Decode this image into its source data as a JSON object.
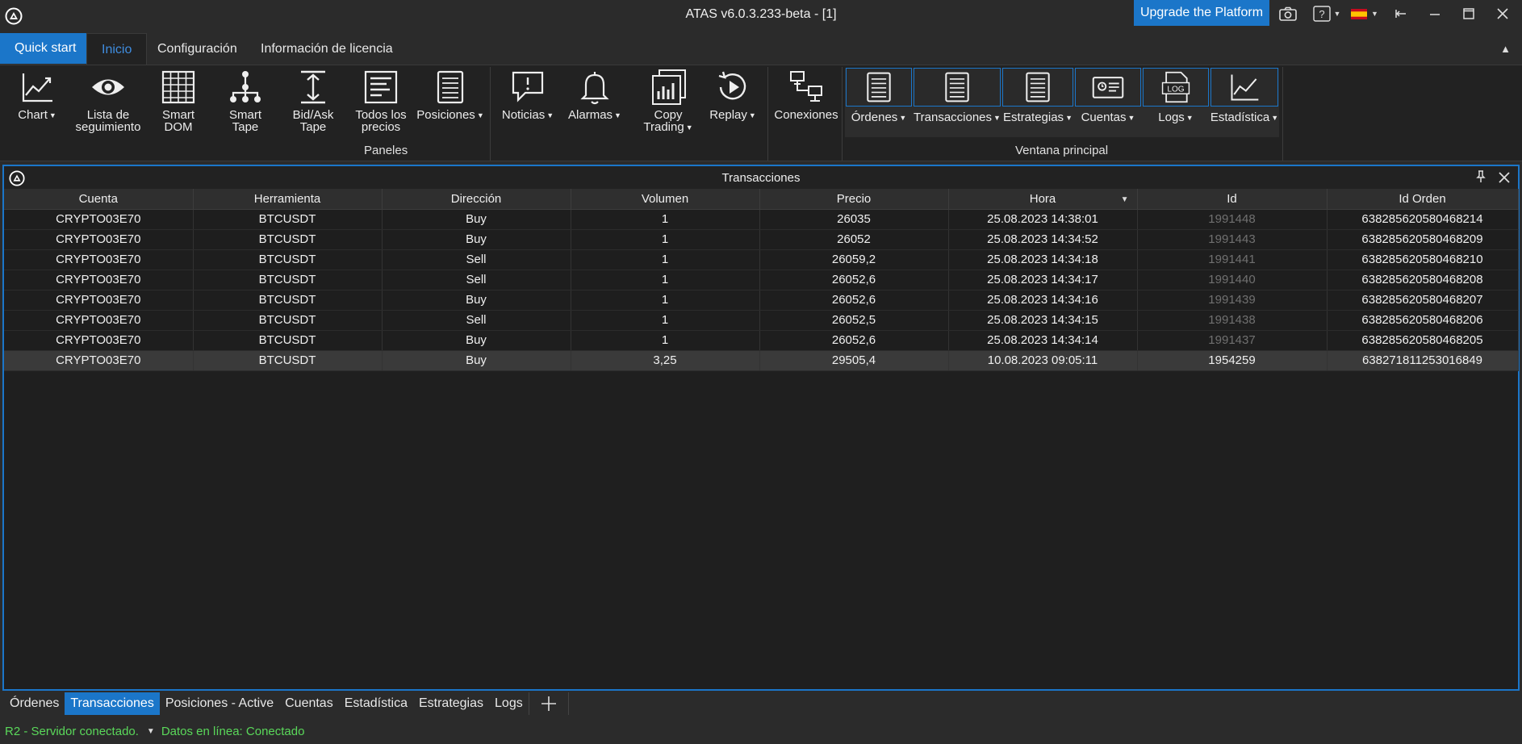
{
  "window": {
    "title": "ATAS v6.0.3.233-beta - [1]",
    "upgrade_label": "Upgrade the Platform"
  },
  "menu": {
    "quick_start": "Quick start",
    "tabs": [
      "Inicio",
      "Configuración",
      "Información de licencia"
    ],
    "active_tab": "Inicio"
  },
  "ribbon": {
    "panels_group_label": "Paneles",
    "main_window_group_label": "Ventana principal",
    "buttons": {
      "chart": "Chart",
      "watchlist_line1": "Lista de",
      "watchlist_line2": "seguimiento",
      "smart_dom_line1": "Smart",
      "smart_dom_line2": "DOM",
      "smart_tape_line1": "Smart",
      "smart_tape_line2": "Tape",
      "bidask_line1": "Bid/Ask",
      "bidask_line2": "Tape",
      "allprices_line1": "Todos los",
      "allprices_line2": "precios",
      "positions": "Posiciones",
      "news": "Noticias",
      "alarms": "Alarmas",
      "copy_line1": "Copy",
      "copy_line2": "Trading",
      "replay": "Replay",
      "connections": "Conexiones",
      "orders": "Órdenes",
      "transactions": "Transacciones",
      "strategies": "Estrategias",
      "accounts": "Cuentas",
      "logs": "Logs",
      "statistics": "Estadística",
      "log_icon_text": "LOG"
    }
  },
  "panel": {
    "title": "Transacciones",
    "columns": [
      "Cuenta",
      "Herramienta",
      "Dirección",
      "Volumen",
      "Precio",
      "Hora",
      "Id",
      "Id Orden"
    ],
    "sorted_column": "Hora",
    "rows": [
      [
        "CRYPTO03E70",
        "BTCUSDT",
        "Buy",
        "1",
        "26035",
        "25.08.2023 14:38:01",
        "1991448",
        "638285620580468214"
      ],
      [
        "CRYPTO03E70",
        "BTCUSDT",
        "Buy",
        "1",
        "26052",
        "25.08.2023 14:34:52",
        "1991443",
        "638285620580468209"
      ],
      [
        "CRYPTO03E70",
        "BTCUSDT",
        "Sell",
        "1",
        "26059,2",
        "25.08.2023 14:34:18",
        "1991441",
        "638285620580468210"
      ],
      [
        "CRYPTO03E70",
        "BTCUSDT",
        "Sell",
        "1",
        "26052,6",
        "25.08.2023 14:34:17",
        "1991440",
        "638285620580468208"
      ],
      [
        "CRYPTO03E70",
        "BTCUSDT",
        "Buy",
        "1",
        "26052,6",
        "25.08.2023 14:34:16",
        "1991439",
        "638285620580468207"
      ],
      [
        "CRYPTO03E70",
        "BTCUSDT",
        "Sell",
        "1",
        "26052,5",
        "25.08.2023 14:34:15",
        "1991438",
        "638285620580468206"
      ],
      [
        "CRYPTO03E70",
        "BTCUSDT",
        "Buy",
        "1",
        "26052,6",
        "25.08.2023 14:34:14",
        "1991437",
        "638285620580468205"
      ],
      [
        "CRYPTO03E70",
        "BTCUSDT",
        "Buy",
        "3,25",
        "29505,4",
        "10.08.2023 09:05:11",
        "1954259",
        "638271811253016849"
      ]
    ],
    "selected_row": 7
  },
  "bottom_tabs": [
    "Órdenes",
    "Transacciones",
    "Posiciones - Active",
    "Cuentas",
    "Estadística",
    "Estrategias",
    "Logs"
  ],
  "bottom_tabs_active": "Transacciones",
  "status": {
    "server": "R2 - Servidor conectado.",
    "data": "Datos en línea: Conectado"
  },
  "colors": {
    "accent": "#1b76c9",
    "status_ok": "#5ad85a",
    "background": "#2b2b2b"
  }
}
